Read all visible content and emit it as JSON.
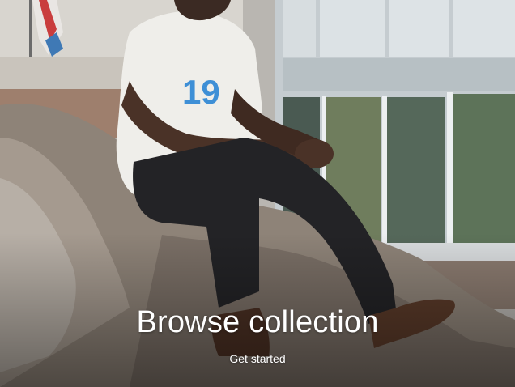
{
  "hero": {
    "title": "Browse collection",
    "cta_label": "Get started"
  },
  "colors": {
    "text": "#ffffff"
  }
}
